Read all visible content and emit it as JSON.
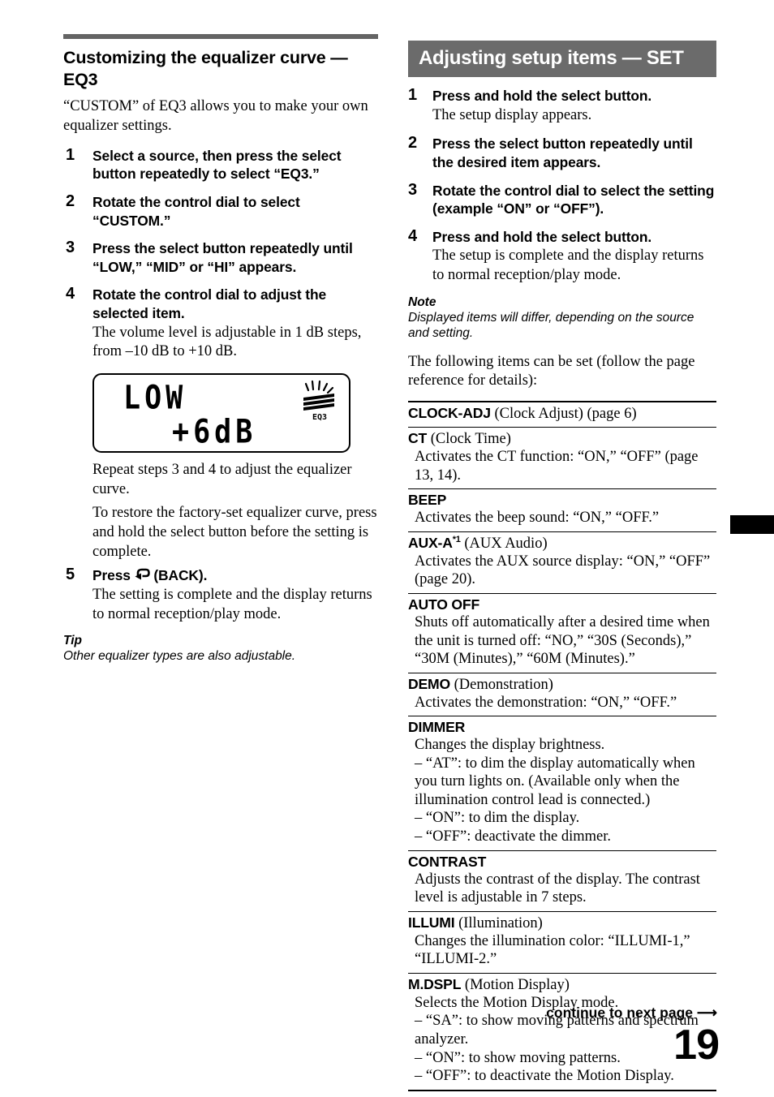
{
  "left_column": {
    "title": "Customizing the equalizer curve — EQ3",
    "intro": "“CUSTOM” of EQ3 allows you to make your own equalizer settings.",
    "steps": [
      {
        "num": "1",
        "head": "Select a source, then press the select button repeatedly to select “EQ3.”",
        "body": ""
      },
      {
        "num": "2",
        "head": "Rotate the control dial to select “CUSTOM.”",
        "body": ""
      },
      {
        "num": "3",
        "head": "Press the select button repeatedly until “LOW,” “MID” or “HI” appears.",
        "body": ""
      },
      {
        "num": "4",
        "head": "Rotate the control dial to adjust the selected item.",
        "body": "The volume level is adjustable in 1 dB steps, from –10 dB to +10 dB."
      }
    ],
    "lcd": {
      "line1": "LOW",
      "line2": "+6dB",
      "icon_label": "EQ3"
    },
    "after_lcd_text_1": "Repeat steps 3 and 4 to adjust the equalizer curve.",
    "after_lcd_text_2": "To restore the factory-set equalizer curve, press and hold the select button before the setting is complete.",
    "step5": {
      "num": "5",
      "head_before_icon": "Press ",
      "head_after_icon": " (BACK).",
      "body": "The setting is complete and the display returns to normal reception/play mode."
    },
    "tip": {
      "label": "Tip",
      "text": "Other equalizer types are also adjustable."
    }
  },
  "right_column": {
    "banner": "Adjusting setup items — SET",
    "steps": [
      {
        "num": "1",
        "head": "Press and hold the select button.",
        "body": "The setup display appears."
      },
      {
        "num": "2",
        "head": "Press the select button repeatedly until the desired item appears.",
        "body": ""
      },
      {
        "num": "3",
        "head": "Rotate the control dial to select the setting (example “ON” or “OFF”).",
        "body": ""
      },
      {
        "num": "4",
        "head": "Press and hold the select button.",
        "body": "The setup is complete and the display returns to normal reception/play mode."
      }
    ],
    "note": {
      "label": "Note",
      "text": "Displayed items will differ, depending on the source and setting."
    },
    "lead_para": "The following items can be set (follow the page reference for details):",
    "settings": [
      {
        "name": "CLOCK-ADJ",
        "paren": " (Clock Adjust) (page 6)",
        "sup": "",
        "desc": []
      },
      {
        "name": "CT",
        "paren": " (Clock Time)",
        "sup": "",
        "desc": [
          "Activates the CT function: “ON,” “OFF” (page 13, 14)."
        ]
      },
      {
        "name": "BEEP",
        "paren": "",
        "sup": "",
        "desc": [
          "Activates the beep sound: “ON,” “OFF.”"
        ]
      },
      {
        "name": "AUX-A",
        "paren": " (AUX Audio)",
        "sup": "*1",
        "desc": [
          "Activates the AUX source display: “ON,” “OFF” (page 20)."
        ]
      },
      {
        "name": "AUTO OFF",
        "paren": "",
        "sup": "",
        "desc": [
          "Shuts off automatically after a desired time when the unit is turned off: “NO,” “30S (Seconds),” “30M (Minutes),” “60M (Minutes).”"
        ]
      },
      {
        "name": "DEMO",
        "paren": " (Demonstration)",
        "sup": "",
        "desc": [
          "Activates the demonstration: “ON,” “OFF.”"
        ]
      },
      {
        "name": "DIMMER",
        "paren": "",
        "sup": "",
        "desc": [
          "Changes the display brightness.",
          "– “AT”: to dim the display automatically when you turn lights on. (Available only when the illumination control lead is connected.)",
          "– “ON”: to dim the display.",
          "– “OFF”: deactivate the dimmer."
        ]
      },
      {
        "name": "CONTRAST",
        "paren": "",
        "sup": "",
        "desc": [
          "Adjusts the contrast of the display. The contrast level is adjustable in 7 steps."
        ]
      },
      {
        "name": "ILLUMI",
        "paren": " (Illumination)",
        "sup": "",
        "desc": [
          "Changes the illumination color: “ILLUMI-1,” “ILLUMI-2.”"
        ]
      },
      {
        "name": "M.DSPL",
        "paren": " (Motion Display)",
        "sup": "",
        "desc": [
          "Selects the Motion Display mode.",
          "– “SA”: to show moving patterns and spectrum analyzer.",
          "– “ON”: to show moving patterns.",
          "– “OFF”: to deactivate the Motion Display."
        ]
      }
    ]
  },
  "footer": {
    "continue_text": "continue to next page",
    "page_number": "19"
  },
  "colors": {
    "banner_grey": "#6b6b6b",
    "rule_grey": "#646464"
  }
}
